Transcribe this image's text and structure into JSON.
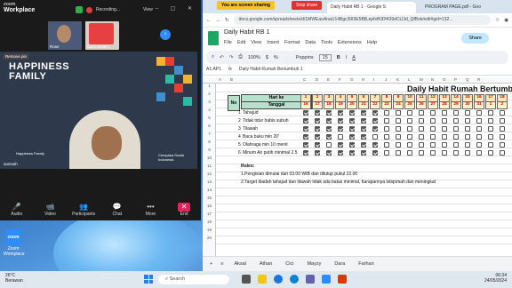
{
  "zoom": {
    "title1": "zoom",
    "title2": "Workplace",
    "recording": "Recording...",
    "view": "View",
    "participants": [
      {
        "name": "Rose"
      },
      {
        "name": "Dara Delaini"
      }
    ],
    "remove": "Remove pin",
    "happy_line1": "HAPPINESS",
    "happy_line2": "FAMILY",
    "tag_left": "Happiness Family",
    "tag_right": "Cempaka Sosial Indonesia",
    "speaker": "samsah",
    "controls": [
      {
        "label": "Audio",
        "icon": "🎤"
      },
      {
        "label": "Video",
        "icon": "📹"
      },
      {
        "label": "Participants",
        "icon": "👥",
        "count": "8"
      },
      {
        "label": "Chat",
        "icon": "💬"
      },
      {
        "label": "More",
        "icon": "•••"
      },
      {
        "label": "End",
        "icon": "✕"
      }
    ]
  },
  "desktop": {
    "zoom_icon_label": "Zoom Workplace",
    "zoom_icon_text": "zoom"
  },
  "browser": {
    "sharing_banner": "You are screen sharing",
    "stop_share": "Stop share",
    "tab1": "Daily Habit RB 1 - Google S",
    "tab2": "PROGRAM PAGE.pdf - Goo",
    "url": "docs.google.com/spreadsheets/d/1MWEaoAnaU14Bgc30I9E5BB,epfxfKlDf439dCtJJd_QfBsk/edit#gid=132...",
    "doc_title": "Daily Habit RB 1",
    "menus": [
      "File",
      "Edit",
      "View",
      "Insert",
      "Format",
      "Data",
      "Tools",
      "Extensions",
      "Help"
    ],
    "share_label": "Share",
    "zoom_level": "100%",
    "font": "Poppins",
    "font_size": "15",
    "cell_ref": "A1:AP1",
    "formula": "Daily Habit Rumah Bertumbuh 1"
  },
  "sheet": {
    "columns": [
      "A",
      "B",
      "C",
      "D",
      "E",
      "F",
      "G",
      "H",
      "I",
      "J",
      "K",
      "L",
      "M",
      "N",
      "O",
      "P",
      "Q",
      "R"
    ],
    "title": "Daily Habit Rumah Bertumbuh",
    "hari_ke": "Hari ke",
    "tanggal": "Tanggal",
    "no_label": "No",
    "day_numbers": [
      "1",
      "2",
      "3",
      "4",
      "5",
      "6",
      "7",
      "8",
      "9",
      "10",
      "11",
      "12",
      "13",
      "14",
      "15",
      "16",
      "17",
      "18"
    ],
    "dates": [
      "16",
      "17",
      "18",
      "19",
      "20",
      "21",
      "22",
      "23",
      "24",
      "25",
      "26",
      "27",
      "28",
      "29",
      "30",
      "31",
      "1",
      "2"
    ],
    "rows": [
      {
        "no": "1",
        "name": "Tahajud",
        "checks": [
          1,
          1,
          1,
          1,
          1,
          1,
          1,
          0,
          0,
          0,
          0,
          0,
          0,
          0,
          0,
          0,
          0,
          0
        ]
      },
      {
        "no": "2",
        "name": "Tidak tidur habis subuh",
        "checks": [
          1,
          1,
          1,
          1,
          1,
          1,
          1,
          0,
          0,
          0,
          0,
          0,
          0,
          0,
          0,
          0,
          0,
          0
        ]
      },
      {
        "no": "3",
        "name": "Tilawah",
        "checks": [
          1,
          1,
          1,
          1,
          1,
          1,
          1,
          0,
          0,
          0,
          0,
          0,
          0,
          0,
          0,
          0,
          0,
          0
        ]
      },
      {
        "no": "4",
        "name": "Baca buku min 20'",
        "checks": [
          1,
          1,
          1,
          0,
          1,
          1,
          0,
          0,
          0,
          0,
          0,
          0,
          0,
          0,
          0,
          0,
          0,
          0
        ]
      },
      {
        "no": "5",
        "name": "Olahraga min 10 menit",
        "checks": [
          1,
          1,
          0,
          1,
          1,
          1,
          1,
          0,
          0,
          0,
          0,
          0,
          0,
          0,
          0,
          0,
          0,
          0
        ]
      },
      {
        "no": "6",
        "name": "Minum Air putih  minimal 2.5",
        "checks": [
          1,
          1,
          1,
          1,
          1,
          1,
          1,
          0,
          0,
          0,
          0,
          0,
          0,
          0,
          0,
          0,
          0,
          0
        ]
      }
    ],
    "rules_title": "Rules:",
    "rule1": "1.Pengisian dimulai dari 03.00 WIB dan ditutup pukul 22.00",
    "rule2": "2.Target ibadah tahajud dan tilawah tidak ada batas minimal, harapannya istiqomah dan meningkat",
    "tabs": [
      "Aksal",
      "Athan",
      "Cici",
      "Mayzy",
      "Dara",
      "Farhan"
    ]
  },
  "taskbar": {
    "temp": "26°C",
    "weather": "Berawan",
    "search": "Search",
    "time": "06:34",
    "date": "24/05/2024"
  },
  "colors": {
    "sheet_header": "#b7e1cd",
    "zoom_bg": "#1a1a1a",
    "sharing": "#f4c430"
  }
}
